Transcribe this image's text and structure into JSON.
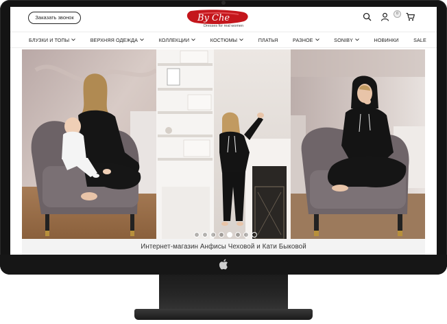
{
  "header": {
    "call_button": "Заказать звонок",
    "logo_text": "By Che",
    "logo_tagline": "Dresses for real women",
    "cart_count": "0"
  },
  "nav": {
    "items": [
      {
        "label": "БЛУЗКИ И ТОПЫ",
        "dropdown": true
      },
      {
        "label": "ВЕРХНЯЯ ОДЕЖДА",
        "dropdown": true
      },
      {
        "label": "КОЛЛЕКЦИИ",
        "dropdown": true
      },
      {
        "label": "КОСТЮМЫ",
        "dropdown": true
      },
      {
        "label": "ПЛАТЬЯ",
        "dropdown": false
      },
      {
        "label": "РАЗНОЕ",
        "dropdown": true
      },
      {
        "label": "SONIBY",
        "dropdown": true
      },
      {
        "label": "НОВИНКИ",
        "dropdown": false
      },
      {
        "label": "SALE",
        "dropdown": false
      }
    ]
  },
  "slider": {
    "dots_total": 8,
    "active_dot": 4
  },
  "caption": "Интернет-магазин Анфисы Чеховой и Кати Быковой",
  "icons": [
    "search-icon",
    "user-icon",
    "cart-icon",
    "chevron-down-icon",
    "apple-logo"
  ],
  "colors": {
    "brand_red": "#c4161c",
    "frame": "#141414",
    "outfit": "#111111"
  }
}
